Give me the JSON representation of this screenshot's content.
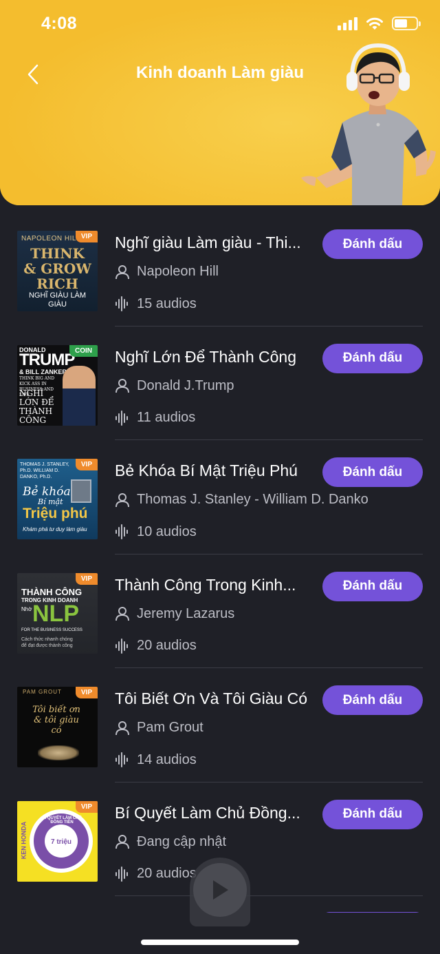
{
  "status_bar": {
    "time": "4:08"
  },
  "header": {
    "title": "Kinh doanh Làm giàu",
    "accent": "#f6c53c"
  },
  "colors": {
    "background": "#1f2027",
    "button": "#7452d9",
    "vip": "#ef8b2c",
    "coin": "#2ea04b"
  },
  "mark_label": "Đánh dấu",
  "books": [
    {
      "title": "Nghĩ giàu Làm giàu - Thi...",
      "author": "Napoleon Hill",
      "count": "15 audios",
      "badge": "VIP",
      "cover_top": "NAPOLEON HILL",
      "cover_main": "THINK & GROW RICH",
      "cover_sub": "NGHĨ GIÀU LÀM GIÀU"
    },
    {
      "title": "Nghĩ Lớn Để Thành Công",
      "author": "Donald J.Trump",
      "count": "11 audios",
      "badge": "COIN",
      "cover_top": "DONALD",
      "cover_main": "TRUMP",
      "cover_mid": "& BILL ZANKER",
      "cover_small": "THINK BIG AND KICK ASS IN BUSINESS AND LIFE",
      "cover_sub": "NGHĨ LỚN ĐỂ THÀNH CÔNG"
    },
    {
      "title": "Bẻ Khóa Bí Mật Triệu Phú",
      "author": "Thomas J. Stanley - William D. Danko",
      "count": "10 audios",
      "badge": "VIP",
      "cover_top": "THOMAS J. STANLEY, Ph.D. WILLIAM D. DANKO, Ph.D.",
      "cover_main": "Bẻ khóa",
      "cover_mid": "Bí mật",
      "cover_big": "Triệu phú",
      "cover_sub": "Khám phá tư duy làm giàu"
    },
    {
      "title": "Thành Công Trong Kinh...",
      "author": "Jeremy Lazarus",
      "count": "20 audios",
      "badge": "VIP",
      "cover_main": "THÀNH CÔNG",
      "cover_mid": "TRONG KINH DOANH",
      "cover_prefix": "Nhờ",
      "cover_big": "NLP",
      "cover_small": "FOR THE BUSINESS SUCCESS",
      "cover_sub": "Cách thức nhanh chóng để đạt được thành công"
    },
    {
      "title": "Tôi Biết Ơn Và Tôi Giàu Có",
      "author": "Pam Grout",
      "count": "14 audios",
      "badge": "VIP",
      "cover_top": "PAM GROUT",
      "cover_main": "Tôi biết ơn & tôi giàu có"
    },
    {
      "title": "Bí Quyết Làm Chủ Đồng...",
      "author": "Đang cập nhật",
      "count": "20 audios",
      "badge": "VIP",
      "cover_side": "KEN HONDA",
      "cover_main": "BÍ QUYẾT LÀM CHỦ ĐỒNG TIỀN",
      "cover_big": "7 triệu"
    }
  ]
}
